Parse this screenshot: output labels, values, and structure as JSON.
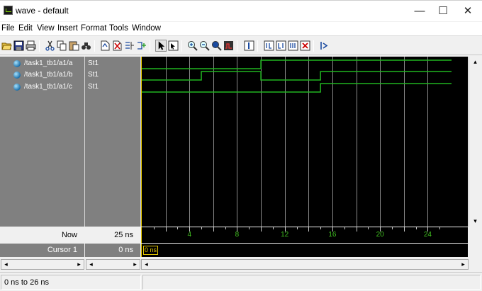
{
  "window": {
    "title": "wave - default",
    "controls": {
      "minimize": "—",
      "maximize": "☐",
      "close": "✕"
    }
  },
  "menu": [
    "File",
    "Edit",
    "View",
    "Insert",
    "Format",
    "Tools",
    "Window"
  ],
  "toolbar_icons": [
    "open-folder-icon",
    "save-icon",
    "print-icon",
    "cut-icon",
    "copy-icon",
    "paste-icon",
    "find-icon",
    "add-signal-icon",
    "delete-signal-icon",
    "insert-divider-icon",
    "insert-breakpoint-icon",
    "select-mode-icon",
    "zoom-mode-icon",
    "zoom-in-icon",
    "zoom-out-icon",
    "zoom-full-icon",
    "zoom-range-icon",
    "add-cursor-icon",
    "find-edge-prev-icon",
    "find-edge-next-icon",
    "find-edge-icon",
    "delete-cursor-icon",
    "step-icon"
  ],
  "signals": [
    {
      "name": "/task1_tb1/a1/a",
      "value": "St1"
    },
    {
      "name": "/task1_tb1/a1/b",
      "value": "St1"
    },
    {
      "name": "/task1_tb1/a1/c",
      "value": "St1"
    }
  ],
  "waveforms": {
    "time_range_ns": [
      0,
      26
    ],
    "signal_transitions_ns": [
      {
        "signal": "/task1_tb1/a1/a",
        "initial": 0,
        "edges": [
          10
        ]
      },
      {
        "signal": "/task1_tb1/a1/b",
        "initial": 0,
        "edges": [
          5,
          10,
          15
        ]
      },
      {
        "signal": "/task1_tb1/a1/c",
        "initial": 0,
        "edges": [
          15
        ]
      }
    ],
    "grid_ns": [
      2,
      4,
      6,
      8,
      10,
      12,
      14,
      16,
      18,
      20,
      22,
      24
    ],
    "tick_labels": [
      "4",
      "8",
      "12",
      "16",
      "20",
      "24"
    ],
    "wave_color": "#21b521",
    "cursor_color": "#e6c800"
  },
  "now": {
    "label": "Now",
    "value": "25 ns"
  },
  "cursor": {
    "label": "Cursor 1",
    "value": "0 ns",
    "tag": "0 ns"
  },
  "scroll_arrows": {
    "left": "◂",
    "right": "▸",
    "up": "▴",
    "down": "▾"
  },
  "status": {
    "range": "0 ns to 26 ns"
  }
}
